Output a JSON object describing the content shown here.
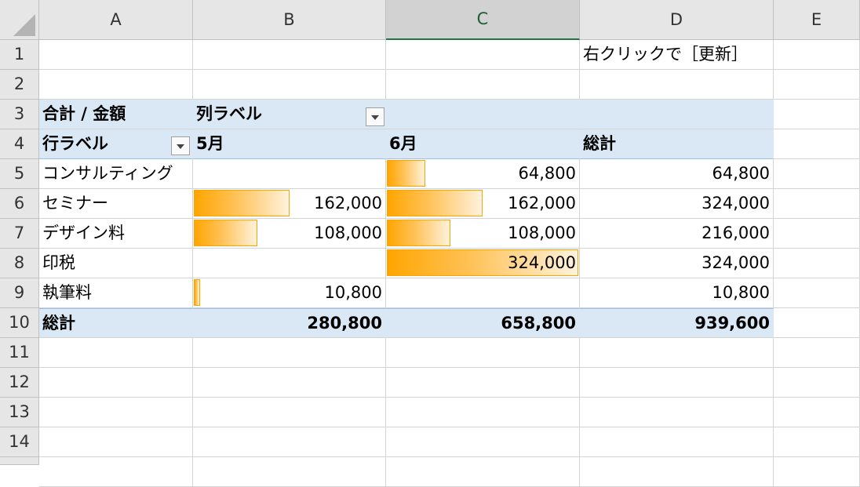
{
  "columns": [
    "A",
    "B",
    "C",
    "D",
    "E"
  ],
  "rows": [
    "1",
    "2",
    "3",
    "4",
    "5",
    "6",
    "7",
    "8",
    "9",
    "10",
    "11",
    "12",
    "13",
    "14"
  ],
  "note": "右クリックで［更新］",
  "pivot": {
    "values_label": "合計 / 金額",
    "col_labels_title": "列ラベル",
    "row_labels_title": "行ラベル",
    "col_headers": [
      "5月",
      "6月",
      "総計"
    ],
    "items": [
      {
        "label": "コンサルティング",
        "may": "",
        "june": "64,800",
        "total": "64,800"
      },
      {
        "label": "セミナー",
        "may": "162,000",
        "june": "162,000",
        "total": "324,000"
      },
      {
        "label": "デザイン料",
        "may": "108,000",
        "june": "108,000",
        "total": "216,000"
      },
      {
        "label": "印税",
        "may": "",
        "june": "324,000",
        "total": "324,000"
      },
      {
        "label": "執筆料",
        "may": "10,800",
        "june": "",
        "total": "10,800"
      }
    ],
    "grand_total_label": "総計",
    "grand_totals": {
      "may": "280,800",
      "june": "658,800",
      "total": "939,600"
    }
  },
  "data_bars": {
    "color": "#ffa500",
    "may": [
      0,
      0.5,
      0.333,
      0,
      0.033
    ],
    "june": [
      0.2,
      0.5,
      0.333,
      1.0,
      0
    ]
  }
}
